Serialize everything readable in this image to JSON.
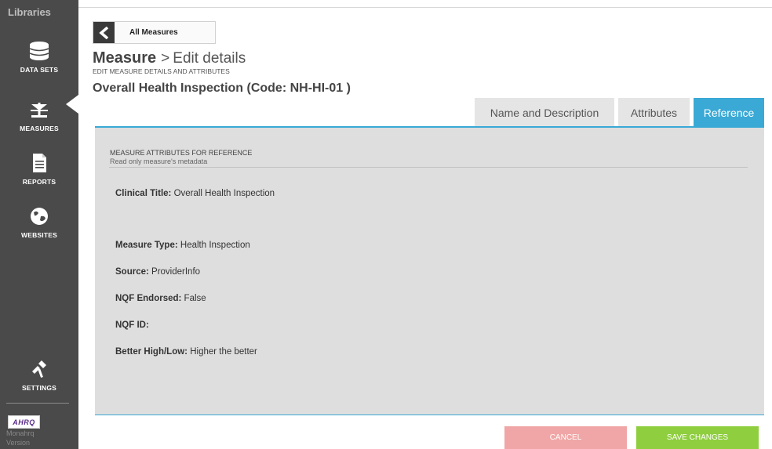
{
  "sidebar": {
    "libraries_label": "Libraries",
    "items": [
      {
        "label": "DATA SETS",
        "icon": "database-icon"
      },
      {
        "label": "MEASURES",
        "icon": "measures-icon"
      },
      {
        "label": "REPORTS",
        "icon": "report-icon"
      },
      {
        "label": "WEBSITES",
        "icon": "globe-icon"
      },
      {
        "label": "SETTINGS",
        "icon": "settings-icon"
      }
    ],
    "logo_text": "AHRQ",
    "footer_line1": "Monahrq",
    "footer_line2": "Version"
  },
  "header": {
    "back_label": "All Measures",
    "title": "Measure",
    "separator": ">",
    "title_sub": "Edit details",
    "subtitle": "EDIT MEASURE DETAILS AND ATTRIBUTES",
    "measure_name": "Overall Health Inspection (Code: NH-HI-01 )"
  },
  "tabs": [
    {
      "label": "Name and Description",
      "active": false
    },
    {
      "label": "Attributes",
      "active": false
    },
    {
      "label": "Reference",
      "active": true
    }
  ],
  "panel": {
    "title": "MEASURE ATTRIBUTES FOR REFERENCE",
    "subtitle": "Read only measure's metadata",
    "attributes": [
      {
        "label": "Clinical Title:",
        "value": "Overall Health Inspection"
      },
      {
        "label": "Measure Type:",
        "value": "Health Inspection"
      },
      {
        "label": "Source:",
        "value": "ProviderInfo"
      },
      {
        "label": "NQF Endorsed:",
        "value": "False"
      },
      {
        "label": "NQF ID:",
        "value": ""
      },
      {
        "label": "Better High/Low:",
        "value": "Higher the better"
      }
    ]
  },
  "footer": {
    "cancel_label": "CANCEL",
    "save_label": "SAVE CHANGES"
  },
  "colors": {
    "sidebar_bg": "#4a4a4a",
    "accent": "#3aa9d6",
    "cancel_bg": "#f0a6a6",
    "save_bg": "#8fce3f",
    "panel_bg": "#dedede"
  }
}
